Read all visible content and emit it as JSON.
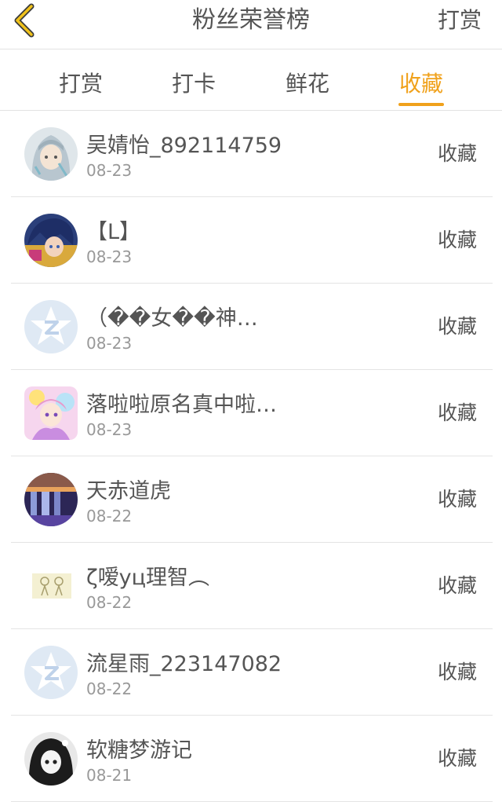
{
  "header": {
    "title": "粉丝荣誉榜",
    "right_action": "打赏"
  },
  "tabs": [
    {
      "label": "打赏",
      "active": false
    },
    {
      "label": "打卡",
      "active": false
    },
    {
      "label": "鲜花",
      "active": false
    },
    {
      "label": "收藏",
      "active": true
    }
  ],
  "colors": {
    "accent": "#f0a11b",
    "text": "#555555",
    "muted": "#999999",
    "divider": "#e4e4e4"
  },
  "rows": [
    {
      "name": "吴婧怡_892114759",
      "date": "08-23",
      "action": "收藏",
      "avatar": "anime-girl-silver-avatar"
    },
    {
      "name": "【L】",
      "date": "08-23",
      "action": "收藏",
      "avatar": "anime-boy-blue-avatar"
    },
    {
      "name": "（��女��神…",
      "date": "08-23",
      "action": "收藏",
      "avatar": "default-star-avatar"
    },
    {
      "name": "落啦啦原名真中啦…",
      "date": "08-23",
      "action": "收藏",
      "avatar": "magical-girl-avatar"
    },
    {
      "name": "天赤道虎",
      "date": "08-22",
      "action": "收藏",
      "avatar": "waterfall-night-avatar"
    },
    {
      "name": "ζ嗳yц理智︵",
      "date": "08-22",
      "action": "收藏",
      "avatar": "sketch-couple-avatar"
    },
    {
      "name": "流星雨_223147082",
      "date": "08-22",
      "action": "收藏",
      "avatar": "default-star-avatar"
    },
    {
      "name": "软糖梦游记",
      "date": "08-21",
      "action": "收藏",
      "avatar": "bw-anime-girl-avatar"
    }
  ]
}
